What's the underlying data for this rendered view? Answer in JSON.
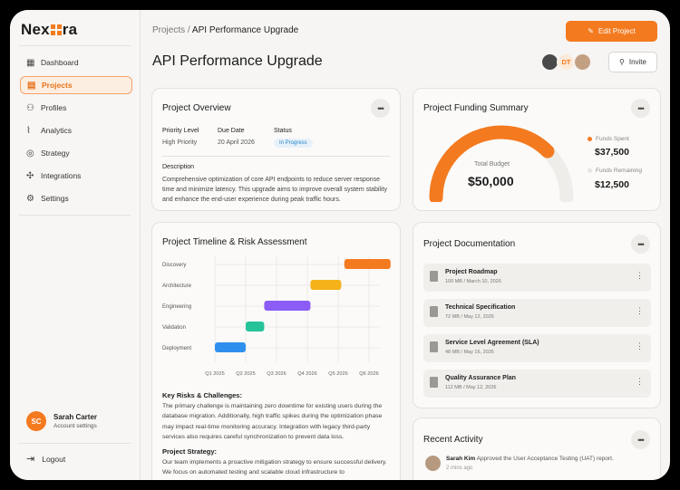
{
  "brand": {
    "logo_a": "Nex",
    "logo_b": "ra"
  },
  "sidebar": {
    "items": [
      {
        "label": "Dashboard",
        "icon": "grid-icon"
      },
      {
        "label": "Projects",
        "icon": "document-icon"
      },
      {
        "label": "Profiles",
        "icon": "users-icon"
      },
      {
        "label": "Analytics",
        "icon": "chart-icon"
      },
      {
        "label": "Strategy",
        "icon": "target-icon"
      },
      {
        "label": "Integrations",
        "icon": "puzzle-icon"
      },
      {
        "label": "Settings",
        "icon": "gear-icon"
      }
    ],
    "user": {
      "initials": "SC",
      "name": "Sarah Carter",
      "sub": "Account settings"
    },
    "logout": "Logout"
  },
  "header": {
    "breadcrumb_parent": "Projects",
    "breadcrumb_current": "API Performance Upgrade",
    "title": "API Performance Upgrade",
    "edit_label": "Edit Project",
    "invite_label": "Invite",
    "avatar_initials": "DT"
  },
  "overview": {
    "title": "Project Overview",
    "priority_label": "Priority Level",
    "priority_value": "High Priority",
    "due_label": "Due Date",
    "due_value": "20 April 2026",
    "status_label": "Status",
    "status_value": "In Progress",
    "desc_label": "Description",
    "desc_text": "Comprehensive optimization of core API endpoints to reduce server response time and minimize latency. This upgrade aims to improve overall system stability and enhance the end-user experience during peak traffic hours."
  },
  "funding": {
    "title": "Project Funding Summary",
    "total_label": "Total Budget",
    "total_value": "$50,000",
    "spent_label": "Funds Spent",
    "spent_value": "$37,500",
    "remaining_label": "Funds Remaining",
    "remaining_value": "$12,500",
    "spent_fraction": 0.75
  },
  "timeline": {
    "title": "Project Timeline & Risk Assessment",
    "risk_heading": "Key Risks & Challenges:",
    "risk_text": "The primary challenge is maintaining zero downtime for existing users during the database migration. Additionally, high traffic spikes during the optimization phase may impact real-time monitoring accuracy. Integration with legacy third-party services also requires careful synchronization to prevent data loss.",
    "strategy_heading": "Project Strategy:",
    "strategy_text": "Our team implements a proactive mitigation strategy to ensure successful delivery. We focus on automated testing and scalable cloud infrastructure to"
  },
  "chart_data": {
    "type": "bar",
    "categories": [
      "Discovery",
      "Architecture",
      "Engineering",
      "Validation",
      "Deployment"
    ],
    "x_ticks": [
      "Q1 2025",
      "Q2 2025",
      "Q3 2026",
      "Q4 2026",
      "Q5 2026",
      "Q6 2026"
    ],
    "ranges": [
      [
        4.2,
        5.7
      ],
      [
        3.1,
        4.1
      ],
      [
        1.6,
        3.1
      ],
      [
        1.0,
        1.6
      ],
      [
        0.0,
        1.0
      ]
    ],
    "colors": [
      "#f47a1f",
      "#f5b21a",
      "#8b5cf6",
      "#26c29a",
      "#2f8fef"
    ],
    "grid": true
  },
  "documents": {
    "title": "Project Documentation",
    "items": [
      {
        "name": "Project Roadmap",
        "meta": "100 MB / March 10, 2026"
      },
      {
        "name": "Technical Specification",
        "meta": "72 MB / May 12, 2026"
      },
      {
        "name": "Service Level Agreement (SLA)",
        "meta": "48 MB / May 16, 2026"
      },
      {
        "name": "Quality Assurance Plan",
        "meta": "112 MB / May 12, 2026"
      }
    ]
  },
  "activity": {
    "title": "Recent Activity",
    "user": "Sarah Kim",
    "text": "Approved the User Acceptance Testing (UAT) report.",
    "time": "2 mins ago"
  },
  "colors": {
    "accent": "#f47a1f",
    "track": "#eeedea"
  }
}
